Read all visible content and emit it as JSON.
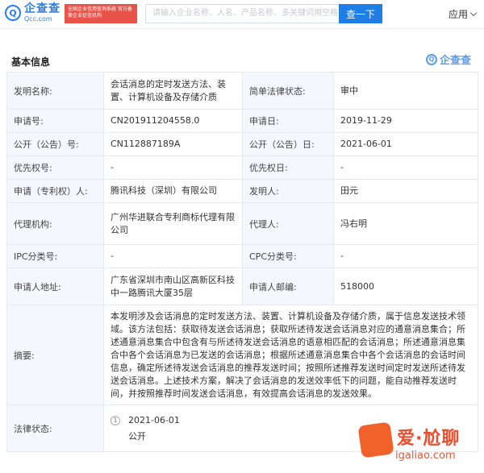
{
  "header": {
    "logo_mark": "Q",
    "logo_cn": "企查查",
    "logo_en": "Qcc.com",
    "promo": "全国企业信用查询系统 官方备案企业征信机构",
    "search_placeholder": "请输入企业名称、人名、产品名称、多关键词用空格",
    "search_button": "查一下",
    "apps_label": "应用"
  },
  "section": {
    "title": "基本信息",
    "watermark_mark": "Q",
    "watermark_text": "企查查"
  },
  "rows": {
    "invention_name_label": "发明名称:",
    "invention_name_value": "会话消息的定时发送方法、装置、计算机设备及存储介质",
    "legal_status_simple_label": "简单法律状态:",
    "legal_status_simple_value": "审中",
    "app_no_label": "申请号:",
    "app_no_value": "CN201911204558.0",
    "app_date_label": "申请日:",
    "app_date_value": "2019-11-29",
    "pub_no_label": "公开（公告）号:",
    "pub_no_value": "CN112887189A",
    "pub_date_label": "公开（公告）日:",
    "pub_date_value": "2021-06-01",
    "priority_no_label": "优先权号:",
    "priority_no_value": "-",
    "priority_date_label": "优先权日:",
    "priority_date_value": "-",
    "applicant_label": "申请（专利权）人:",
    "applicant_value": "腾讯科技（深圳）有限公司",
    "inventor_label": "发明人:",
    "inventor_value": "田元",
    "agency_label": "代理机构:",
    "agency_value": "广州华进联合专利商标代理有限公司",
    "agent_label": "代理人:",
    "agent_value": "冯右明",
    "ipc_label": "IPC分类号:",
    "ipc_value": "-",
    "cpc_label": "CPC分类号:",
    "cpc_value": "-",
    "address_label": "申请人地址:",
    "address_value": "广东省深圳市南山区高新区科技中一路腾讯大厦35层",
    "postcode_label": "申请人邮编:",
    "postcode_value": "518000",
    "abstract_label": "摘要:",
    "abstract_value": "本发明涉及会话消息的定时发送方法、装置、计算机设备及存储介质，属于信息发送技术领域。该方法包括：获取待发送会话消息；获取所述待发送会话消息对应的通意消息集合；所述通意消息集合中包含有与所述待发送会话消息的语意相匹配的会话消息；所述通意消息集合中各个会话消息为已发送的会话消息；根据所述通意消息集合中各个会话消息的会话时间信息，确定所述待发送会话消息的推荐发送时间；按照所述推荐发送时间定时发送所述待发送会话消息。上述技术方案，解决了会话消息的发送效率低下的问题，能自动推荐发送时间，并按照推荐时间发送会话消息，有效提高会话消息的发送效果。",
    "legal_status_label": "法律状态:",
    "legal_step": "1",
    "legal_date": "2021-06-01",
    "legal_event": "公开"
  },
  "site_watermark": {
    "cn": "爱·尬聊",
    "url": "igaliao.com"
  },
  "colors": {
    "brand_blue": "#2b7fe6",
    "link_blue": "#2f7fd9",
    "label_bg": "#f4f7fb",
    "promo_red": "#e8534a"
  }
}
